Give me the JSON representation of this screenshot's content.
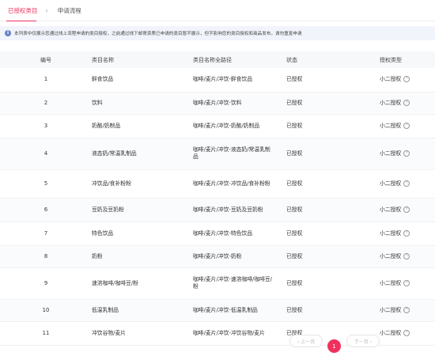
{
  "tabs": [
    {
      "label": "已授权类目",
      "active": true
    },
    {
      "label": "申请流程",
      "active": false
    }
  ],
  "tab_separator": "›",
  "notice": {
    "icon": "info-icon",
    "text": "本列表中仅展示您通过线上流程申请的类目授权，之前通过线下邮寄资质已申请的类目暂不展示，但不影响您的类目授权和商品发布，请勿重复申请"
  },
  "table": {
    "headers": [
      "编号",
      "类目名称",
      "类目名称全路径",
      "状态",
      "授权类型"
    ],
    "rows": [
      {
        "id": "1",
        "name": "鲜食饮品",
        "path": "咖啡/麦片/冲饮-鲜食饮品",
        "status": "已授权",
        "type": "小二授权"
      },
      {
        "id": "2",
        "name": "饮料",
        "path": "咖啡/麦片/冲饮-饮料",
        "status": "已授权",
        "type": "小二授权"
      },
      {
        "id": "3",
        "name": "奶酪/奶制品",
        "path": "咖啡/麦片/冲饮-奶酪/奶制品",
        "status": "已授权",
        "type": "小二授权"
      },
      {
        "id": "4",
        "name": "液态奶/常温乳制品",
        "path": "咖啡/麦片/冲饮-液态奶/常温乳制品",
        "status": "已授权",
        "type": "小二授权"
      },
      {
        "id": "5",
        "name": "冲饮品/食补粉粉",
        "path": "咖啡/麦片/冲饮-冲饮品/食补粉粉",
        "status": "已授权",
        "type": "小二授权"
      },
      {
        "id": "6",
        "name": "豆奶及豆奶粉",
        "path": "咖啡/麦片/冲饮-豆奶及豆奶粉",
        "status": "已授权",
        "type": "小二授权"
      },
      {
        "id": "7",
        "name": "特色饮品",
        "path": "咖啡/麦片/冲饮-特色饮品",
        "status": "已授权",
        "type": "小二授权"
      },
      {
        "id": "8",
        "name": "奶粉",
        "path": "咖啡/麦片/冲饮-奶粉",
        "status": "已授权",
        "type": "小二授权"
      },
      {
        "id": "9",
        "name": "速溶咖啡/咖啡豆/粉",
        "path": "咖啡/麦片/冲饮-速溶咖啡/咖啡豆/粉",
        "status": "已授权",
        "type": "小二授权"
      },
      {
        "id": "10",
        "name": "低温乳制品",
        "path": "咖啡/麦片/冲饮-低温乳制品",
        "status": "已授权",
        "type": "小二授权"
      },
      {
        "id": "11",
        "name": "冲饮谷物/麦片",
        "path": "咖啡/麦片/冲饮-冲饮谷物/麦片",
        "status": "已授权",
        "type": "小二授权"
      }
    ]
  },
  "help_glyph": "?",
  "pagination": {
    "prev_label": "‹ 上一页",
    "current_page": "1",
    "next_label": "下一页 ›"
  },
  "colors": {
    "accent": "#f0315d",
    "notice_bg": "#f1f4fb",
    "info_icon": "#6b82c7"
  }
}
